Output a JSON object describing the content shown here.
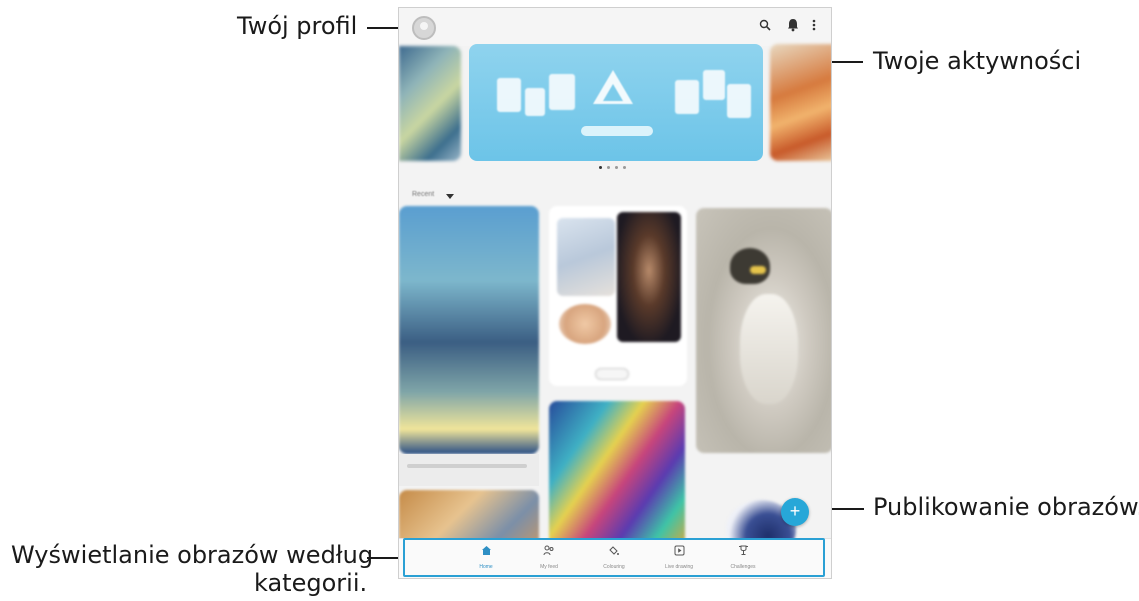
{
  "callouts": {
    "profile": "Twój profil",
    "activities": "Twoje aktywności",
    "publish": "Publikowanie obrazów.",
    "categories_line1": "Wyświetlanie obrazów według",
    "categories_line2": "kategorii."
  },
  "topbar": {
    "search_icon": "search-icon",
    "bell_icon": "bell-icon",
    "more_icon": "more-vertical-icon"
  },
  "carousel": {
    "pages": 4,
    "active_page": 1
  },
  "sort": {
    "label": "Recent"
  },
  "fab": {
    "label": "+"
  },
  "bottom_nav": {
    "items": [
      {
        "label": "Home",
        "icon": "home-icon"
      },
      {
        "label": "My feed",
        "icon": "users-icon"
      },
      {
        "label": "Colouring",
        "icon": "paint-bucket-icon"
      },
      {
        "label": "Live drawing",
        "icon": "play-icon"
      },
      {
        "label": "Challenges",
        "icon": "trophy-icon"
      }
    ],
    "active_index": 0
  },
  "colors": {
    "accent": "#2aa0d4",
    "fab": "#27a7d8"
  }
}
